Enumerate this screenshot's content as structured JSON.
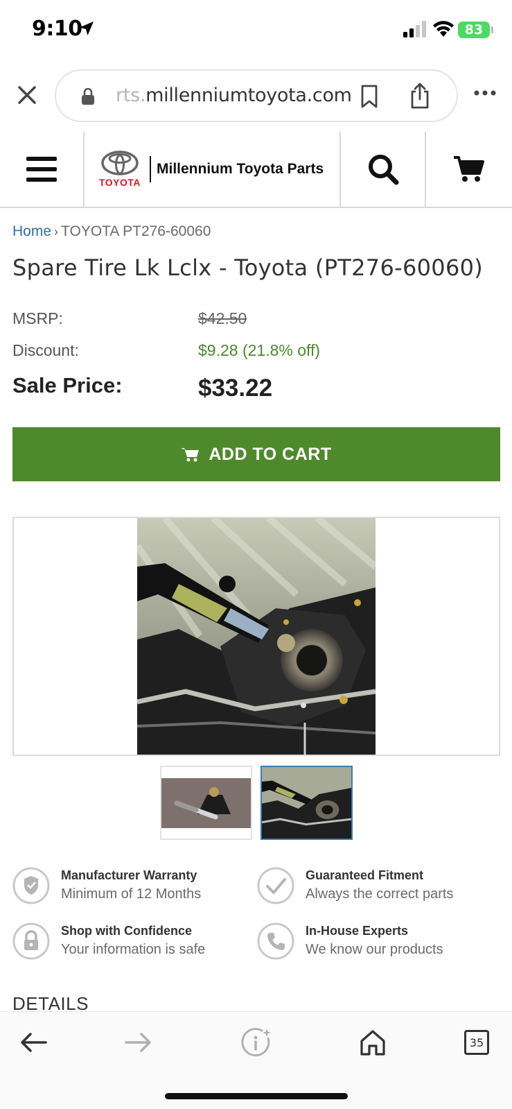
{
  "status": {
    "time": "9:10",
    "battery": "83"
  },
  "browser": {
    "url_faded": "rts.",
    "url_main": "millenniumtoyota.com",
    "tab_count": "35"
  },
  "header": {
    "brand_wordmark": "TOYOTA",
    "site_name": "Millennium Toyota Parts"
  },
  "breadcrumb": {
    "home": "Home",
    "separator": "›",
    "current": "TOYOTA PT276-60060"
  },
  "product": {
    "title": "Spare Tire Lk Lclx - Toyota (PT276-60060)",
    "msrp_label": "MSRP:",
    "msrp_value": "$42.50",
    "discount_label": "Discount:",
    "discount_value": "$9.28 (21.8% off)",
    "sale_label": "Sale Price:",
    "sale_value": "$33.22",
    "add_to_cart": "ADD TO CART"
  },
  "gallery": {
    "selected_index": 1,
    "thumbnails": 2
  },
  "features": [
    {
      "title": "Manufacturer Warranty",
      "subtitle": "Minimum of 12 Months",
      "icon": "shield-icon"
    },
    {
      "title": "Guaranteed Fitment",
      "subtitle": "Always the correct parts",
      "icon": "check-icon"
    },
    {
      "title": "Shop with Confidence",
      "subtitle": "Your information is safe",
      "icon": "lock-icon"
    },
    {
      "title": "In-House Experts",
      "subtitle": "We know our products",
      "icon": "phone-icon"
    }
  ],
  "details_heading": "DETAILS",
  "colors": {
    "accent_green": "#4e8a2b",
    "discount_green": "#4a8a2a",
    "link_blue": "#2b6fae",
    "toyota_red": "#d71920",
    "battery_green": "#4cd964"
  }
}
